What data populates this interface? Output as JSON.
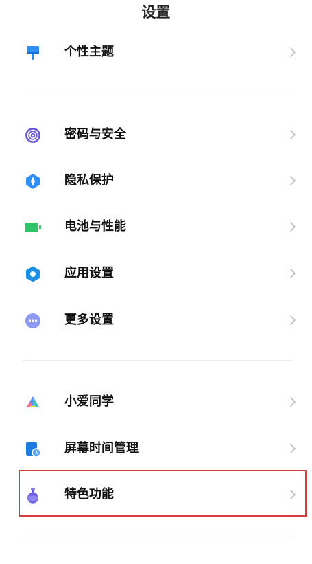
{
  "header": {
    "title": "设置"
  },
  "settings": {
    "items": [
      {
        "label": "个性主题",
        "icon": "paint-brush-icon",
        "color": "#2f8ef5"
      },
      {
        "label": "密码与安全",
        "icon": "fingerprint-icon",
        "color": "#6b5bd9"
      },
      {
        "label": "隐私保护",
        "icon": "privacy-shield-icon",
        "color": "#2f8ef5"
      },
      {
        "label": "电池与性能",
        "icon": "battery-icon",
        "color": "#2ec46a"
      },
      {
        "label": "应用设置",
        "icon": "gear-icon",
        "color": "#1b8fe6"
      },
      {
        "label": "更多设置",
        "icon": "more-dots-icon",
        "color": "#8e99f3"
      },
      {
        "label": "小爱同学",
        "icon": "xiaoai-icon",
        "color": "#5b8cff"
      },
      {
        "label": "屏幕时间管理",
        "icon": "screen-time-icon",
        "color": "#1e7be0"
      },
      {
        "label": "特色功能",
        "icon": "flask-icon",
        "color": "#6a5ce0"
      }
    ]
  },
  "highlight": {
    "color": "#d63c3c",
    "target": "特色功能"
  }
}
